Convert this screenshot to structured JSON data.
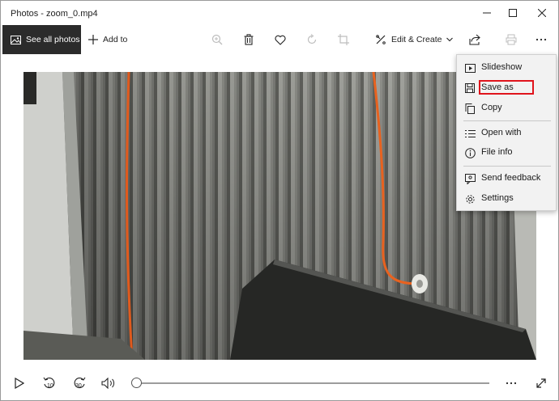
{
  "window": {
    "title": "Photos - zoom_0.mp4"
  },
  "toolbar": {
    "see_all_photos": "See all photos",
    "add_to": "Add to",
    "edit_create": "Edit & Create",
    "icons": [
      "zoom-icon",
      "delete-icon",
      "favorite-icon",
      "rotate-icon",
      "crop-icon",
      "share-icon",
      "print-icon",
      "more-icon"
    ]
  },
  "menu": {
    "items": [
      {
        "label": "Slideshow",
        "icon": "slideshow-icon"
      },
      {
        "label": "Save as",
        "icon": "save-icon"
      },
      {
        "label": "Copy",
        "icon": "copy-icon"
      },
      {
        "label": "Open with",
        "icon": "open-with-icon"
      },
      {
        "label": "File info",
        "icon": "info-icon"
      },
      {
        "label": "Send feedback",
        "icon": "feedback-icon"
      },
      {
        "label": "Settings",
        "icon": "settings-icon"
      }
    ],
    "highlighted": "Save as",
    "highlight_color": "#e0141c"
  },
  "player": {
    "skip_back_label": "10",
    "skip_forward_label": "30",
    "progress": 0
  },
  "colors": {
    "see_all_bg": "#2b2b2b",
    "menu_bg": "#f2f2f2"
  }
}
